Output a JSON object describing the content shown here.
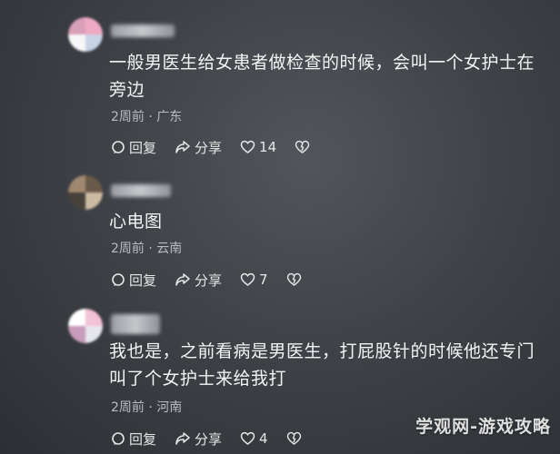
{
  "comments": [
    {
      "text": "一般男医生给女患者做检查的时候，会叫一个女护士在旁边",
      "time": "2周前",
      "location": "广东",
      "reply_label": "回复",
      "share_label": "分享",
      "like_count": "14"
    },
    {
      "text": "心电图",
      "time": "2周前",
      "location": "云南",
      "reply_label": "回复",
      "share_label": "分享",
      "like_count": "7"
    },
    {
      "text": "我也是，之前看病是男医生，打屁股针的时候他还专门叫了个女护士来给我打",
      "time": "2周前",
      "location": "河南",
      "reply_label": "回复",
      "share_label": "分享",
      "like_count": "4"
    }
  ],
  "meta_separator": "·",
  "watermark": "学观网-游戏攻略",
  "icons": [
    "reply-icon",
    "share-icon",
    "like-icon",
    "dislike-icon"
  ]
}
